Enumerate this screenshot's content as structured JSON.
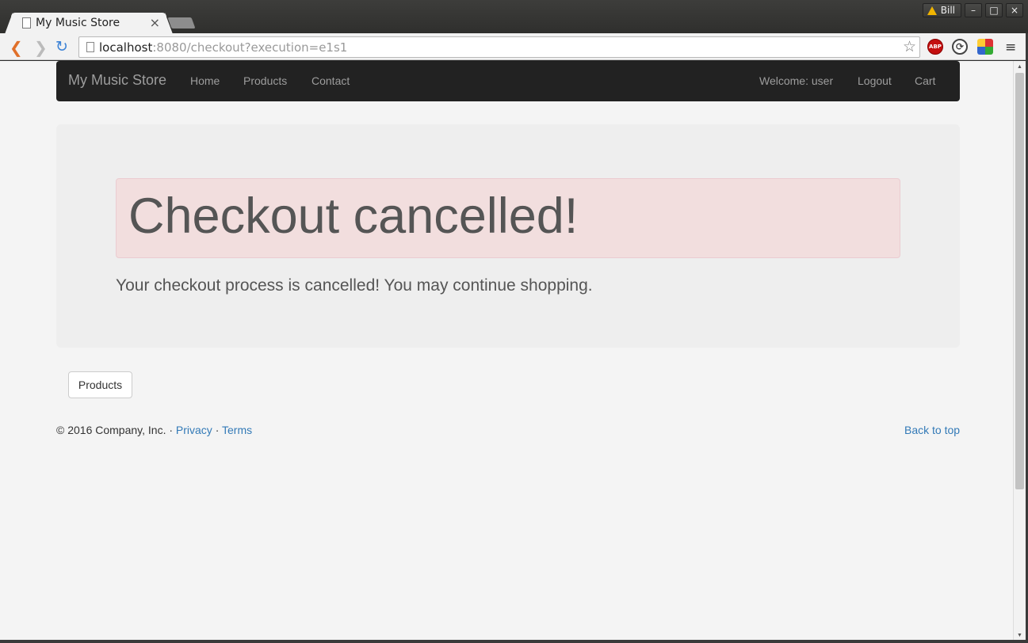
{
  "browser": {
    "tab_title": "My Music Store",
    "tab_close": "×",
    "user_name": "Bill",
    "window_buttons": [
      "–",
      "□",
      "×"
    ],
    "url_host": "localhost",
    "url_rest": ":8080/checkout?execution=e1s1",
    "back_glyph": "❮",
    "forward_glyph": "❯",
    "reload_glyph": "↻",
    "star_glyph": "☆",
    "menu_glyph": "≡",
    "abp_label": "ABP",
    "sync_glyph": "⟳"
  },
  "navbar": {
    "brand": "My Music Store",
    "left_links": [
      "Home",
      "Products",
      "Contact"
    ],
    "welcome": "Welcome: user",
    "logout": "Logout",
    "cart": "Cart"
  },
  "main": {
    "heading": "Checkout cancelled!",
    "message": "Your checkout process is cancelled! You may continue shopping.",
    "products_button": "Products"
  },
  "footer": {
    "copyright": "© 2016 Company, Inc. · ",
    "privacy": "Privacy",
    "separator": " · ",
    "terms": "Terms",
    "back_to_top": "Back to top"
  },
  "colors": {
    "navbar_bg": "#222222",
    "alert_bg": "#f2dede",
    "link": "#337ab7",
    "jumbotron_bg": "#eeeeee"
  }
}
